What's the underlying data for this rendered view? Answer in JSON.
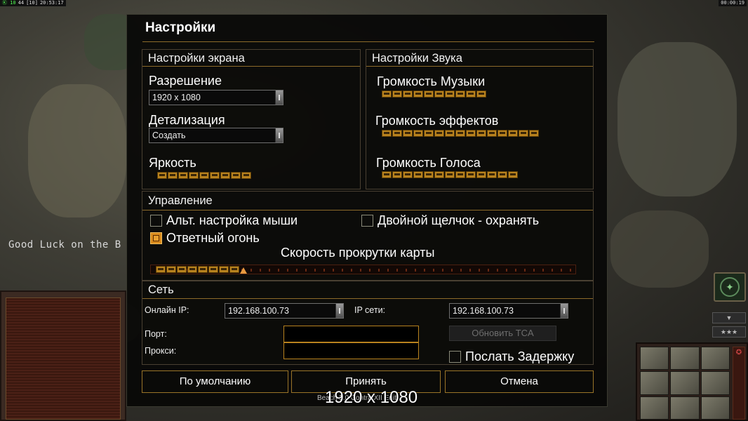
{
  "hud": {
    "top_left_green": "Ⓚ 10",
    "top_left_a": "44",
    "top_left_b": "[10]",
    "top_left_clock": "20:53:17",
    "top_right_clock": "00:00:19",
    "chat_message": "Good Luck on the B"
  },
  "dialog": {
    "title": "Настройки",
    "screen": {
      "title": "Настройки экрана",
      "resolution_label": "Разрешение",
      "resolution_value": "1920 x 1080",
      "detail_label": "Детализация",
      "detail_value": "Создать",
      "brightness_label": "Яркость",
      "brightness_segments": 9
    },
    "sound": {
      "title": "Настройки Звука",
      "music_label": "Громкость Музыки",
      "music_segments": 10,
      "effects_label": "Громкость эффектов",
      "effects_segments": 15,
      "voice_label": "Громкость Голоса",
      "voice_segments": 13
    },
    "controls": {
      "title": "Управление",
      "alt_mouse_label": "Альт. настройка мыши",
      "alt_mouse_checked": false,
      "double_click_label": "Двойной щелчок - охранять",
      "double_click_checked": false,
      "retaliation_label": "Ответный огонь",
      "retaliation_checked": true,
      "scroll_speed_label": "Скорость прокрутки карты",
      "scroll_speed_fraction": 0.21
    },
    "network": {
      "title": "Сеть",
      "online_ip_label": "Онлайн IP:",
      "online_ip_value": "192.168.100.73",
      "lan_ip_label": "IP сети:",
      "lan_ip_value": "192.168.100.73",
      "port_label": "Порт:",
      "proxy_label": "Прокси:",
      "update_tca_label": "Обновить TCA",
      "send_delay_label": "Послать Задержку",
      "send_delay_checked": false
    },
    "buttons": {
      "defaults": "По умолчанию",
      "accept": "Принять",
      "cancel": "Отмена"
    },
    "footer_text": "Beach 2.0 Contra XII Edit",
    "overlay_resolution": "1920 x 1080"
  },
  "colors": {
    "accent_gold": "#b8821e",
    "checkbox_checked": "#d98a1c"
  }
}
